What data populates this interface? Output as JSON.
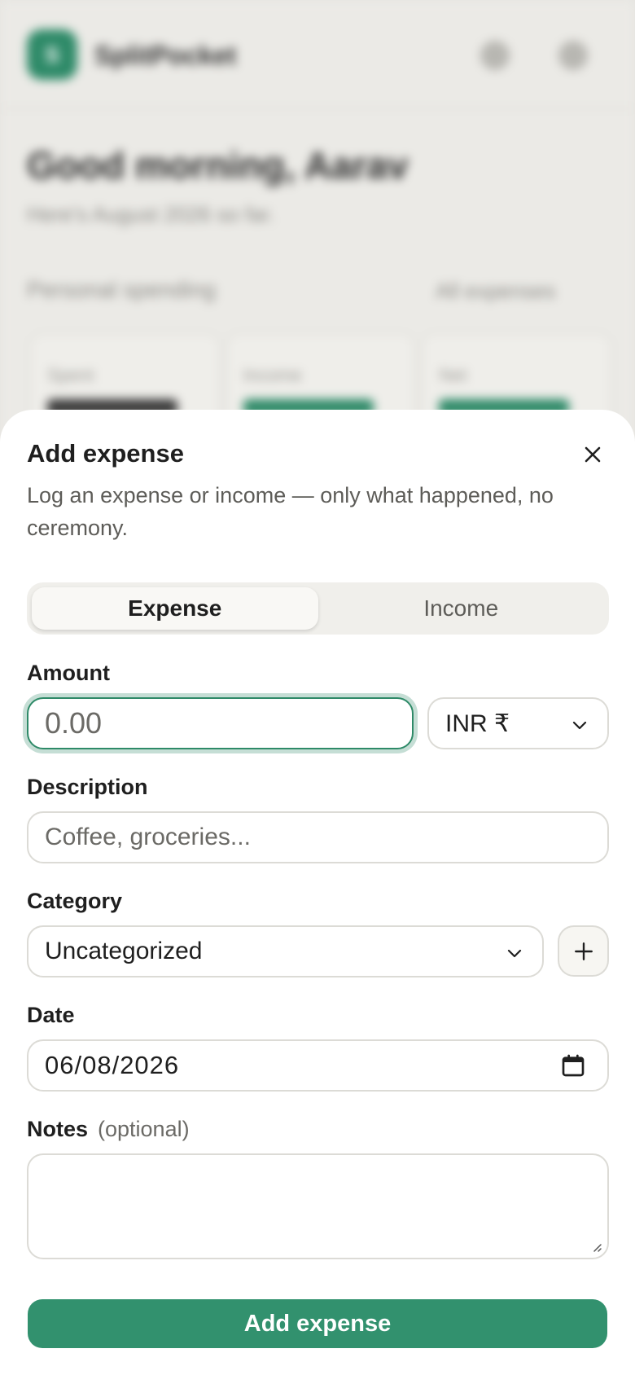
{
  "background": {
    "brand": "SplitPocket",
    "greeting": "Good morning, Aarav",
    "subtitle": "Here's August 2026 so far.",
    "section_title": "Personal spending",
    "section_link": "All expenses",
    "cards": [
      {
        "label": "Spent",
        "color": "#3a3a3a"
      },
      {
        "label": "Income",
        "color": "#2e8a68"
      },
      {
        "label": "Net",
        "color": "#2e8a68"
      }
    ]
  },
  "sheet": {
    "title": "Add expense",
    "description": "Log an expense or income — only what happened, no ceremony.",
    "type_toggle": {
      "options": [
        "Expense",
        "Income"
      ],
      "selected": "Expense"
    },
    "amount": {
      "label": "Amount",
      "placeholder": "0.00",
      "value": ""
    },
    "currency": {
      "selected": "INR ₹"
    },
    "description_field": {
      "label": "Description",
      "placeholder": "Coffee, groceries..."
    },
    "category": {
      "label": "Category",
      "selected": "Uncategorized"
    },
    "date": {
      "label": "Date",
      "value": "06/08/2026"
    },
    "notes": {
      "label": "Notes",
      "optional_hint": "(optional)",
      "value": ""
    },
    "submit_label": "Add expense"
  },
  "colors": {
    "accent": "#32916e",
    "focus_ring": "#2e8a68"
  },
  "icons": {
    "close": "close-icon",
    "chevron": "chevron-down-icon",
    "plus": "plus-icon",
    "calendar": "calendar-icon"
  }
}
